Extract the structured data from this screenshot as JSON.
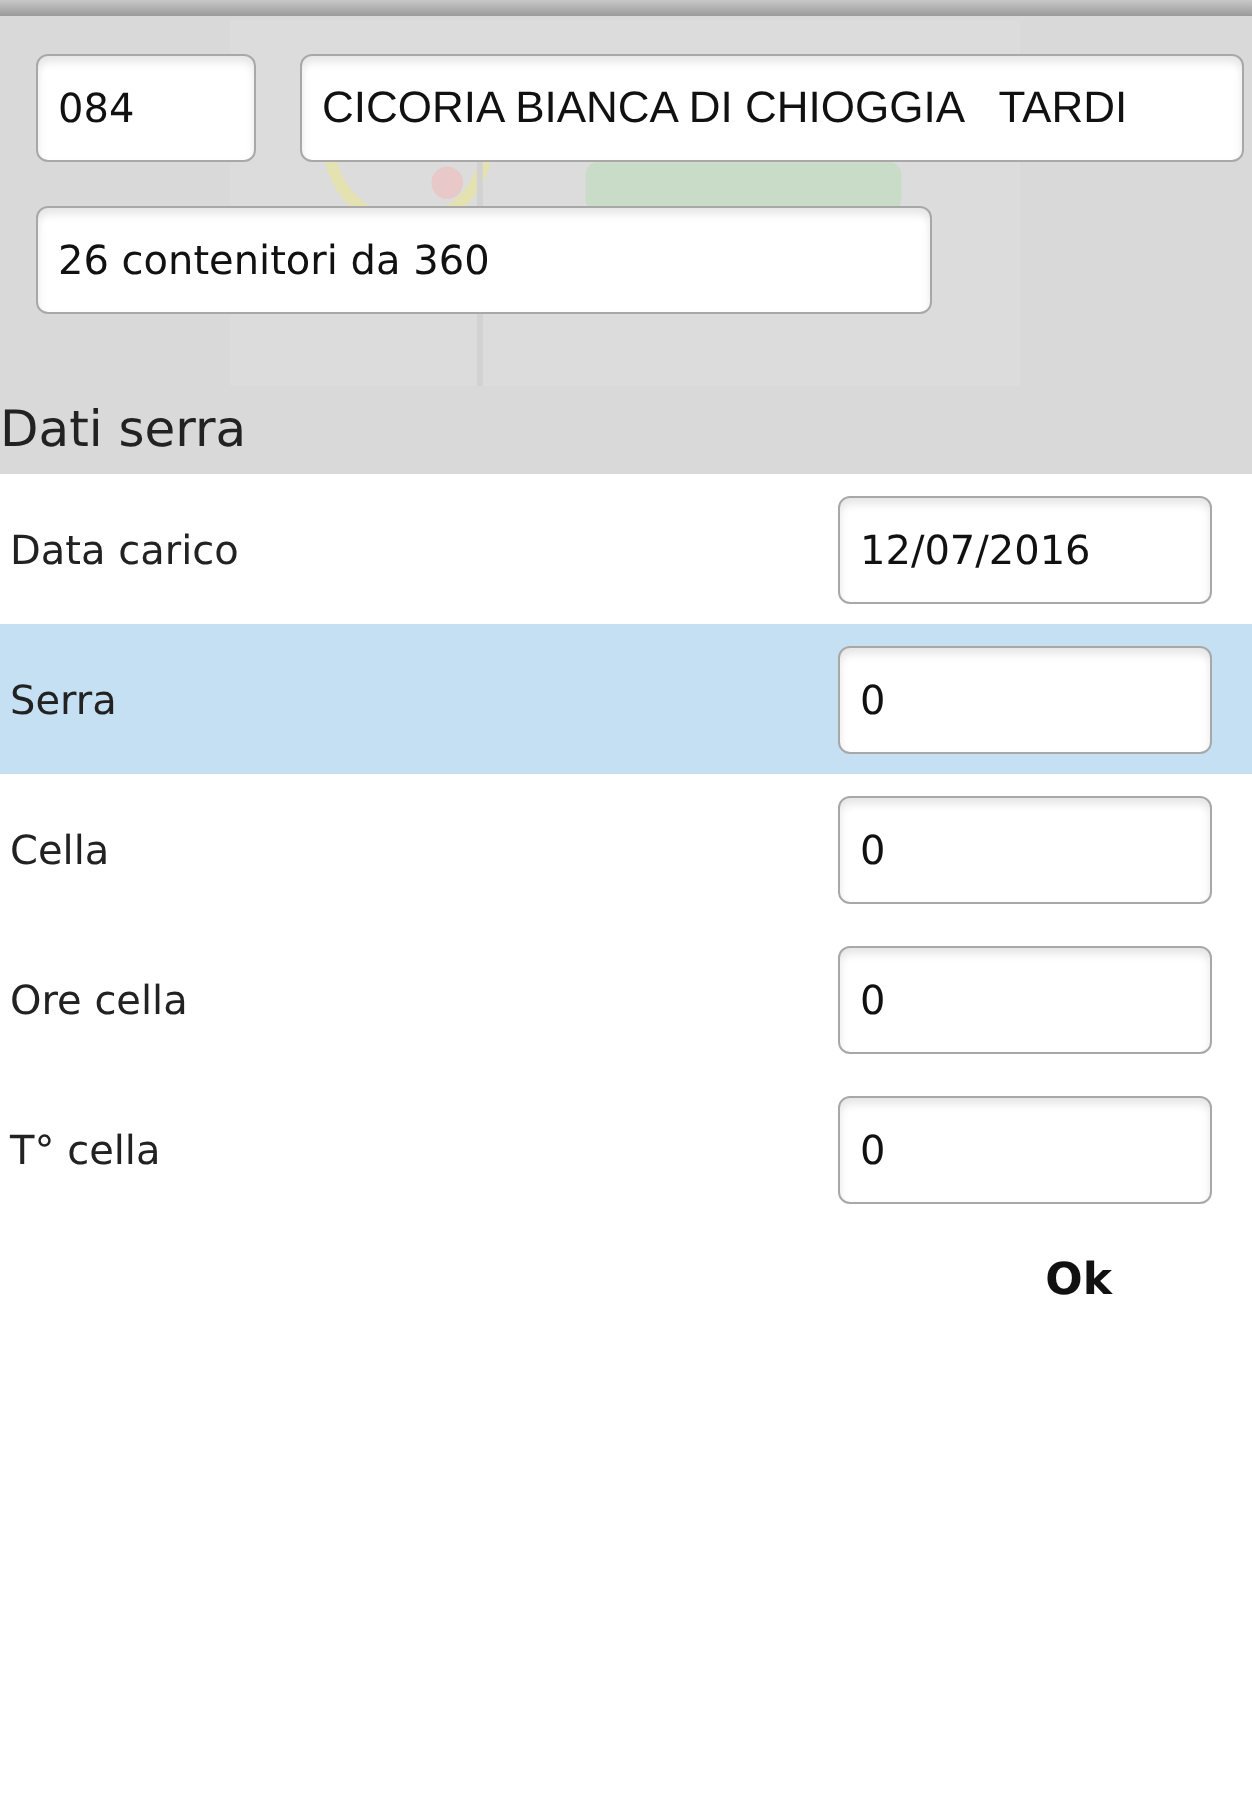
{
  "header": {
    "code": "084",
    "product": "CICORIA BIANCA DI CHIOGGIA   TARDI",
    "containers": "26 contenitori da 360"
  },
  "section_title": "Dati serra",
  "rows": [
    {
      "label": "Data carico",
      "value": "12/07/2016",
      "selected": false
    },
    {
      "label": "Serra",
      "value": "0",
      "selected": true
    },
    {
      "label": "Cella",
      "value": "0",
      "selected": false
    },
    {
      "label": "Ore cella",
      "value": "0",
      "selected": false
    },
    {
      "label": "T° cella",
      "value": "0",
      "selected": false
    }
  ],
  "ok_button": "Ok"
}
